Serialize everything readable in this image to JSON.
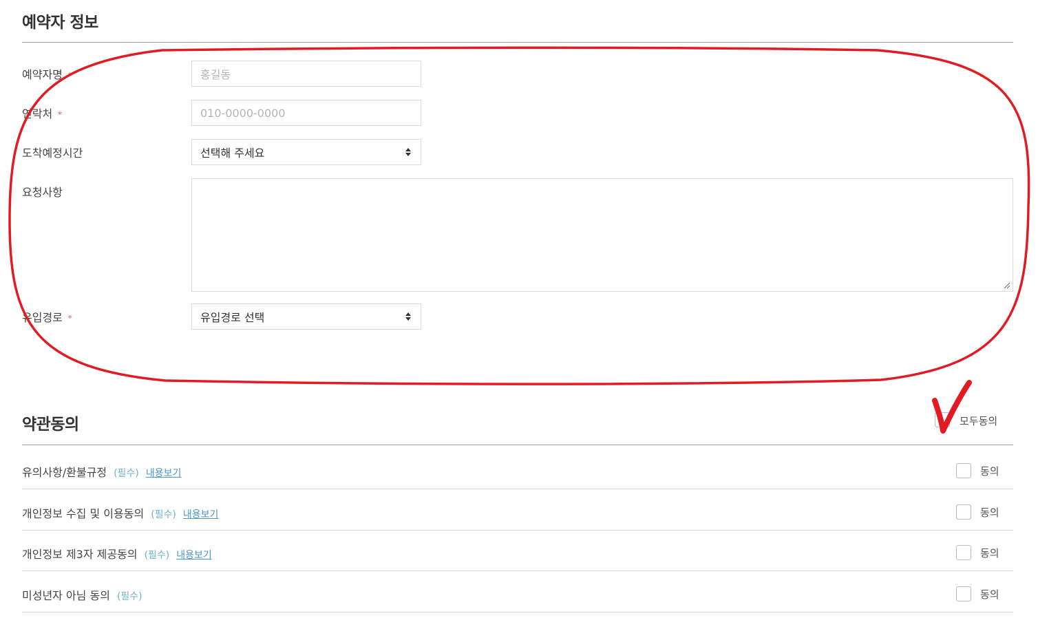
{
  "reservation": {
    "title": "예약자 정보",
    "name_label": "예약자명",
    "name_placeholder": "홍길동",
    "phone_label": "연락처",
    "phone_placeholder": "010-0000-0000",
    "arrival_label": "도착예정시간",
    "arrival_value": "선택해 주세요",
    "request_label": "요청사항",
    "request_value": "",
    "route_label": "유입경로",
    "route_value": "유입경로 선택",
    "required_mark": "*"
  },
  "terms": {
    "title": "약관동의",
    "agree_all_label": "모두동의",
    "required_tag": "(필수)",
    "view_link": "내용보기",
    "agree_label": "동의",
    "items": [
      {
        "label": "유의사항/환불규정",
        "has_view": true
      },
      {
        "label": "개인정보 수집 및 이용동의",
        "has_view": true
      },
      {
        "label": "개인정보 제3자 제공동의",
        "has_view": true
      },
      {
        "label": "미성년자 아님 동의",
        "has_view": false
      }
    ]
  },
  "annotations": {
    "color": "#e21b23"
  }
}
